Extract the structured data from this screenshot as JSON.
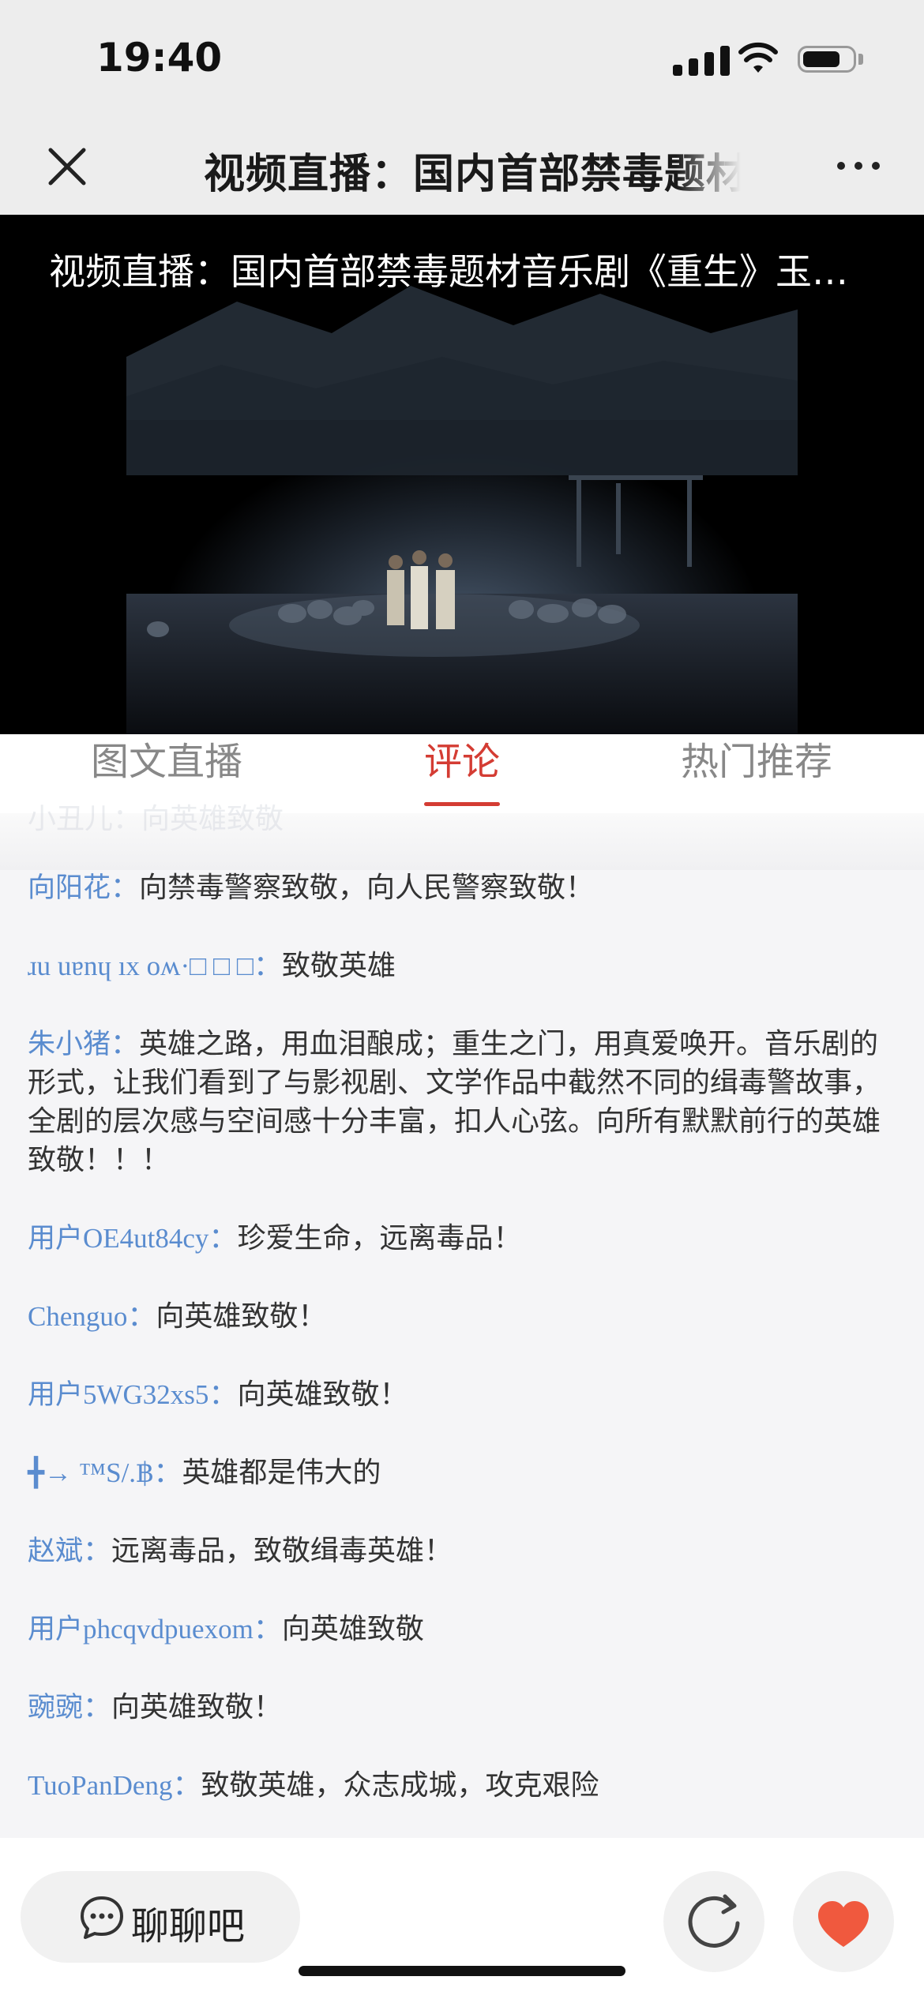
{
  "status_bar": {
    "time": "19:40"
  },
  "nav": {
    "title": "视频直播：国内首部禁毒题材"
  },
  "video": {
    "title": "视频直播：国内首部禁毒题材音乐剧《重生》玉…"
  },
  "tabs": [
    {
      "label": "图文直播",
      "active": false
    },
    {
      "label": "评论",
      "active": true
    },
    {
      "label": "热门推荐",
      "active": false
    }
  ],
  "ghost_comment": "小丑儿：向英雄致敬",
  "comments": [
    {
      "user": "向阳花",
      "text": "向禁毒警察致敬，向人民警察致敬！"
    },
    {
      "user": "ɹu uɐnɥ ıx oʍ·",
      "boxes": "□ □ □",
      "text": "致敬英雄"
    },
    {
      "user": "朱小猪",
      "text": "英雄之路，用血泪酿成；重生之门，用真爱唤开。音乐剧的形式，让我们看到了与影视剧、文学作品中截然不同的缉毒警故事，全剧的层次感与空间感十分丰富，扣人心弦。向所有默默前行的英雄致敬！！！"
    },
    {
      "user": "用户OE4ut84cy",
      "text": "珍爱生命，远离毒品！"
    },
    {
      "user": "Chenguo",
      "text": "向英雄致敬！"
    },
    {
      "user": "用户5WG32xs5",
      "text": "向英雄致敬！"
    },
    {
      "user": "╋→ ™S/.฿",
      "text": "英雄都是伟大的"
    },
    {
      "user": "赵斌",
      "text": "远离毒品，致敬缉毒英雄！"
    },
    {
      "user": "用户phcqvdpuexom",
      "text": "向英雄致敬"
    },
    {
      "user": "豌豌",
      "text": "向英雄致敬！"
    },
    {
      "user": "TuoPanDeng",
      "text": "致敬英雄，众志成城，攻克艰险"
    }
  ],
  "comment_separator": "：",
  "bottom_bar": {
    "chat_label": "聊聊吧"
  },
  "colors": {
    "accent": "#d43c33",
    "username": "#5a8ccf",
    "like": "#f0593e"
  }
}
